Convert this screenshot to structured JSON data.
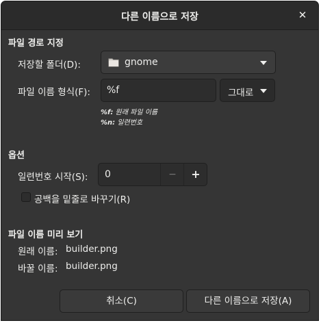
{
  "window": {
    "title": "다른 이름으로 저장"
  },
  "path_section": {
    "heading": "파일 경로 지정",
    "folder_label": "저장할 폴더(D):",
    "folder_value": "gnome",
    "format_label": "파일 이름 형식(F):",
    "format_value": "%f",
    "format_mode": "그대로",
    "hint_f_key": "%f:",
    "hint_f_text": " 원래 파일 이름",
    "hint_n_key": "%n:",
    "hint_n_text": " 일련번호"
  },
  "options_section": {
    "heading": "옵션",
    "serial_label": "일련번호 시작(S):",
    "serial_value": "0",
    "minus": "−",
    "plus": "+",
    "underscore_label": "공백을 밑줄로 바꾸기(R)"
  },
  "preview_section": {
    "heading": "파일 이름 미리 보기",
    "original_label": "원래 이름:",
    "original_value": "builder.png",
    "changed_label": "바꿀 이름:",
    "changed_value": "builder.png"
  },
  "buttons": {
    "cancel": "취소(C)",
    "save": "다른 이름으로 저장(A)"
  },
  "icons": {
    "close": "close-icon",
    "folder": "folder-icon",
    "dropdown": "chevron-down-icon"
  }
}
